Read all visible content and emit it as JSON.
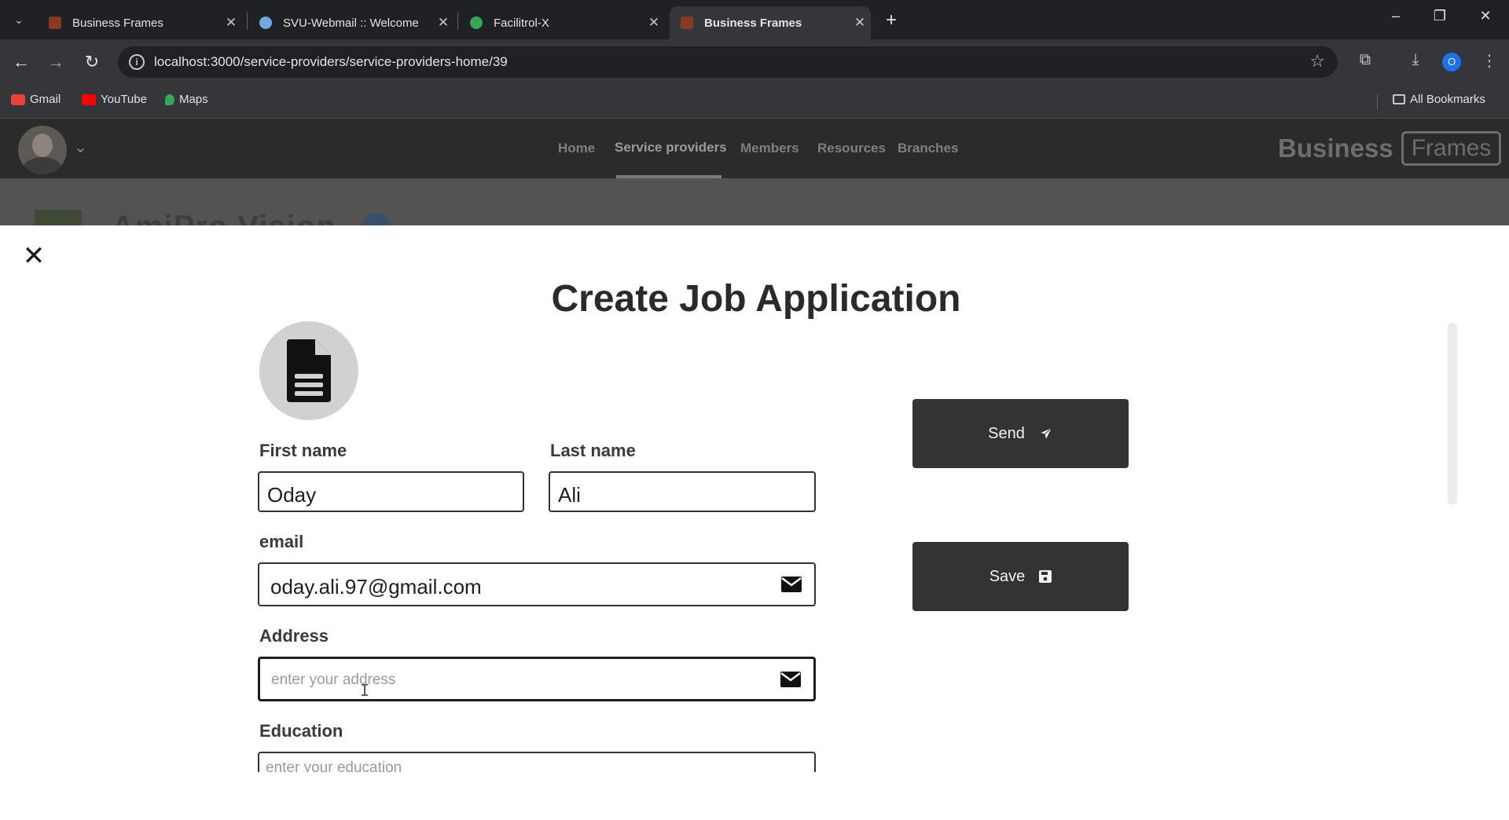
{
  "browser": {
    "tabs": [
      {
        "title": "Business Frames",
        "favicon_color": "#8a3b1f"
      },
      {
        "title": "SVU-Webmail :: Welcome",
        "favicon_color": "#6fa8dc"
      },
      {
        "title": "Facilitrol-X",
        "favicon_color": "#34a853"
      },
      {
        "title": "Business Frames",
        "favicon_color": "#8a3b1f"
      }
    ],
    "active_tab_index": 3,
    "url": "localhost:3000/service-providers/service-providers-home/39",
    "profile_initial": "O",
    "bookmarks": [
      {
        "label": "Gmail",
        "color": "#ea4335"
      },
      {
        "label": "YouTube",
        "color": "#ff0000"
      },
      {
        "label": "Maps",
        "color": "#34a853"
      }
    ],
    "all_bookmarks": "All Bookmarks"
  },
  "app": {
    "nav": [
      "Home",
      "Service providers",
      "Members",
      "Resources",
      "Branches"
    ],
    "active_nav": "Service providers",
    "brand_word1": "Business",
    "brand_word2": "Frames",
    "page_heading_partial": "AmiPro Vision"
  },
  "modal": {
    "title": "Create Job Application",
    "first_name_label": "First name",
    "first_name_value": "Oday",
    "last_name_label": "Last name",
    "last_name_value": "Ali",
    "email_label": "email",
    "email_value": "oday.ali.97@gmail.com",
    "address_label": "Address",
    "address_placeholder": "enter your address",
    "education_label": "Education",
    "education_placeholder": "enter your education",
    "send_label": "Send",
    "save_label": "Save",
    "button_color": "#333333"
  }
}
